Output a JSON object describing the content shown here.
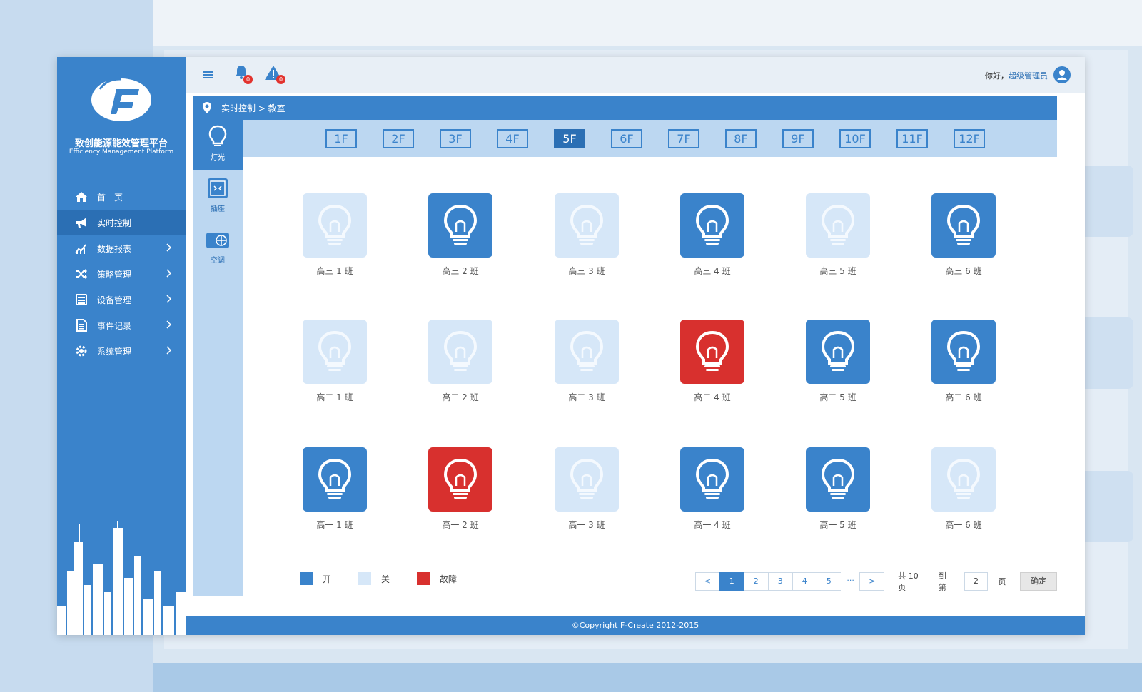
{
  "app": {
    "brand_cn": "致创能源能效管理平台",
    "brand_en": "Efficiency Management Platform"
  },
  "topbar": {
    "bell_count": "0",
    "warning_count": "0",
    "greeting": "你好，",
    "username": "超级管理员"
  },
  "sidebar": {
    "items": [
      {
        "label": "首　页",
        "icon": "home-icon",
        "has_arrow": false
      },
      {
        "label": "实时控制",
        "icon": "megaphone-icon",
        "has_arrow": false
      },
      {
        "label": "数据报表",
        "icon": "chart-icon",
        "has_arrow": true
      },
      {
        "label": "策略管理",
        "icon": "shuffle-icon",
        "has_arrow": true
      },
      {
        "label": "设备管理",
        "icon": "device-icon",
        "has_arrow": true
      },
      {
        "label": "事件记录",
        "icon": "document-icon",
        "has_arrow": true
      },
      {
        "label": "系统管理",
        "icon": "gear-icon",
        "has_arrow": true
      }
    ],
    "active_index": 1
  },
  "breadcrumb": "实时控制 > 教室",
  "categories": [
    {
      "label": "灯光",
      "icon": "bulb-icon"
    },
    {
      "label": "插座",
      "icon": "socket-icon"
    },
    {
      "label": "空调",
      "icon": "aircon-icon"
    }
  ],
  "active_category": 0,
  "floors": [
    "1F",
    "2F",
    "3F",
    "4F",
    "5F",
    "6F",
    "7F",
    "8F",
    "9F",
    "10F",
    "11F",
    "12F"
  ],
  "active_floor": "5F",
  "rooms": [
    {
      "label": "高三 1 班",
      "status": "off"
    },
    {
      "label": "高三 2 班",
      "status": "on"
    },
    {
      "label": "高三 3 班",
      "status": "off"
    },
    {
      "label": "高三 4 班",
      "status": "on"
    },
    {
      "label": "高三 5 班",
      "status": "off"
    },
    {
      "label": "高三 6 班",
      "status": "on"
    },
    {
      "label": "高二 1 班",
      "status": "off"
    },
    {
      "label": "高二 2 班",
      "status": "off"
    },
    {
      "label": "高二 3 班",
      "status": "off"
    },
    {
      "label": "高二 4 班",
      "status": "fault"
    },
    {
      "label": "高二 5 班",
      "status": "on"
    },
    {
      "label": "高二 6 班",
      "status": "on"
    },
    {
      "label": "高一 1 班",
      "status": "on"
    },
    {
      "label": "高一 2 班",
      "status": "fault"
    },
    {
      "label": "高一 3 班",
      "status": "off"
    },
    {
      "label": "高一 4 班",
      "status": "on"
    },
    {
      "label": "高一 5 班",
      "status": "on"
    },
    {
      "label": "高一 6 班",
      "status": "off"
    }
  ],
  "legend": {
    "on": "开",
    "off": "关",
    "fault": "故障"
  },
  "colors": {
    "on": "#3a83cb",
    "off": "#d6e7f8",
    "fault": "#d8302e"
  },
  "pagination": {
    "prev": "<",
    "pages": [
      "1",
      "2",
      "3",
      "4",
      "5"
    ],
    "ellipsis": "···",
    "next": ">",
    "current": "1",
    "total_text": "共 10 页",
    "goto_label": "到第",
    "goto_value": "2",
    "page_unit": "页",
    "confirm": "确定"
  },
  "footer": "©Copyright F-Create 2012-2015"
}
